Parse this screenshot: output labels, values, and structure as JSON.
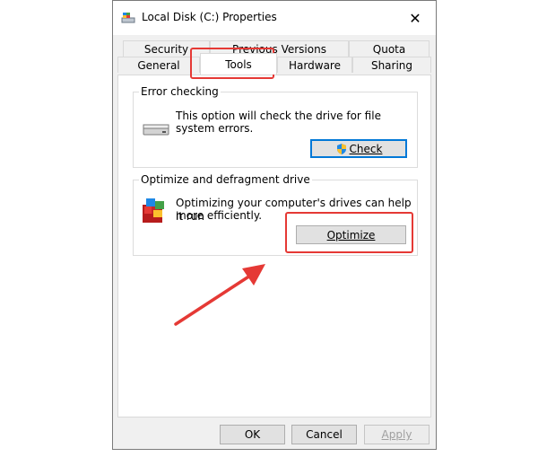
{
  "window": {
    "title": "Local Disk (C:) Properties",
    "icon": "drive-icon",
    "close_glyph": "✕"
  },
  "tabs": {
    "row1": [
      {
        "label": "Security"
      },
      {
        "label": "Previous Versions"
      },
      {
        "label": "Quota"
      }
    ],
    "row2": [
      {
        "label": "General"
      },
      {
        "label": "Tools"
      },
      {
        "label": "Hardware"
      },
      {
        "label": "Sharing"
      }
    ],
    "active": "Tools"
  },
  "error_checking": {
    "group_label": "Error checking",
    "description_line1": "This option will check the drive for file",
    "description_line2": "system errors.",
    "button_label": "Check",
    "button_icon": "shield-icon"
  },
  "optimize": {
    "group_label": "Optimize and defragment drive",
    "description_line1": "Optimizing your computer's drives can help it run",
    "description_line2": "more efficiently.",
    "button_label": "Optimize",
    "icon": "defrag-icon"
  },
  "footer": {
    "ok": "OK",
    "cancel": "Cancel",
    "apply": "Apply"
  },
  "annotations": {
    "highlight_color": "#e53935"
  }
}
